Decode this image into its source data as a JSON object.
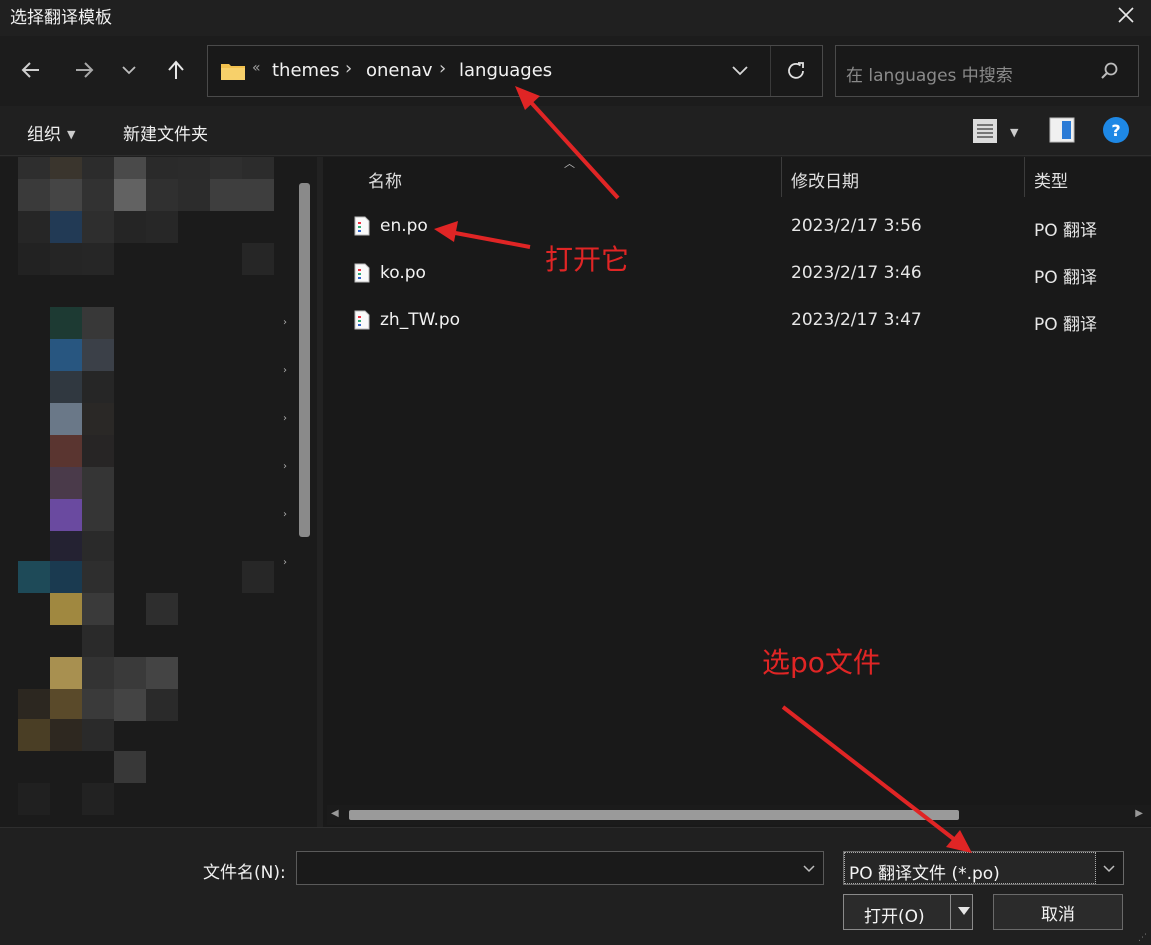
{
  "window": {
    "title": "选择翻译模板",
    "close_icon": "close-icon"
  },
  "nav": {
    "back_icon": "back-arrow-icon",
    "forward_icon": "forward-arrow-icon",
    "recent_icon": "chevron-down-icon",
    "up_icon": "up-arrow-icon"
  },
  "address": {
    "overflow": "«",
    "crumbs": [
      "themes",
      "onenav",
      "languages"
    ],
    "separator": "›"
  },
  "search": {
    "placeholder": "在 languages 中搜索"
  },
  "toolbar": {
    "organize_label": "组织",
    "new_folder_label": "新建文件夹"
  },
  "columns": {
    "name": "名称",
    "date": "修改日期",
    "type": "类型"
  },
  "files": [
    {
      "name": "en.po",
      "date": "2023/2/17 3:56",
      "type": "PO 翻译"
    },
    {
      "name": "ko.po",
      "date": "2023/2/17 3:46",
      "type": "PO 翻译"
    },
    {
      "name": "zh_TW.po",
      "date": "2023/2/17 3:47",
      "type": "PO 翻译"
    }
  ],
  "bottom": {
    "filename_label": "文件名(N):",
    "filename_value": "",
    "filetype_value": "PO 翻译文件 (*.po)",
    "open_label": "打开(O)",
    "cancel_label": "取消"
  },
  "annotations": {
    "open_it": "打开它",
    "select_po": "选po文件"
  },
  "colors": {
    "accent": "#1e88e5",
    "annotation": "#e02525",
    "folder": "#f2c14e"
  }
}
